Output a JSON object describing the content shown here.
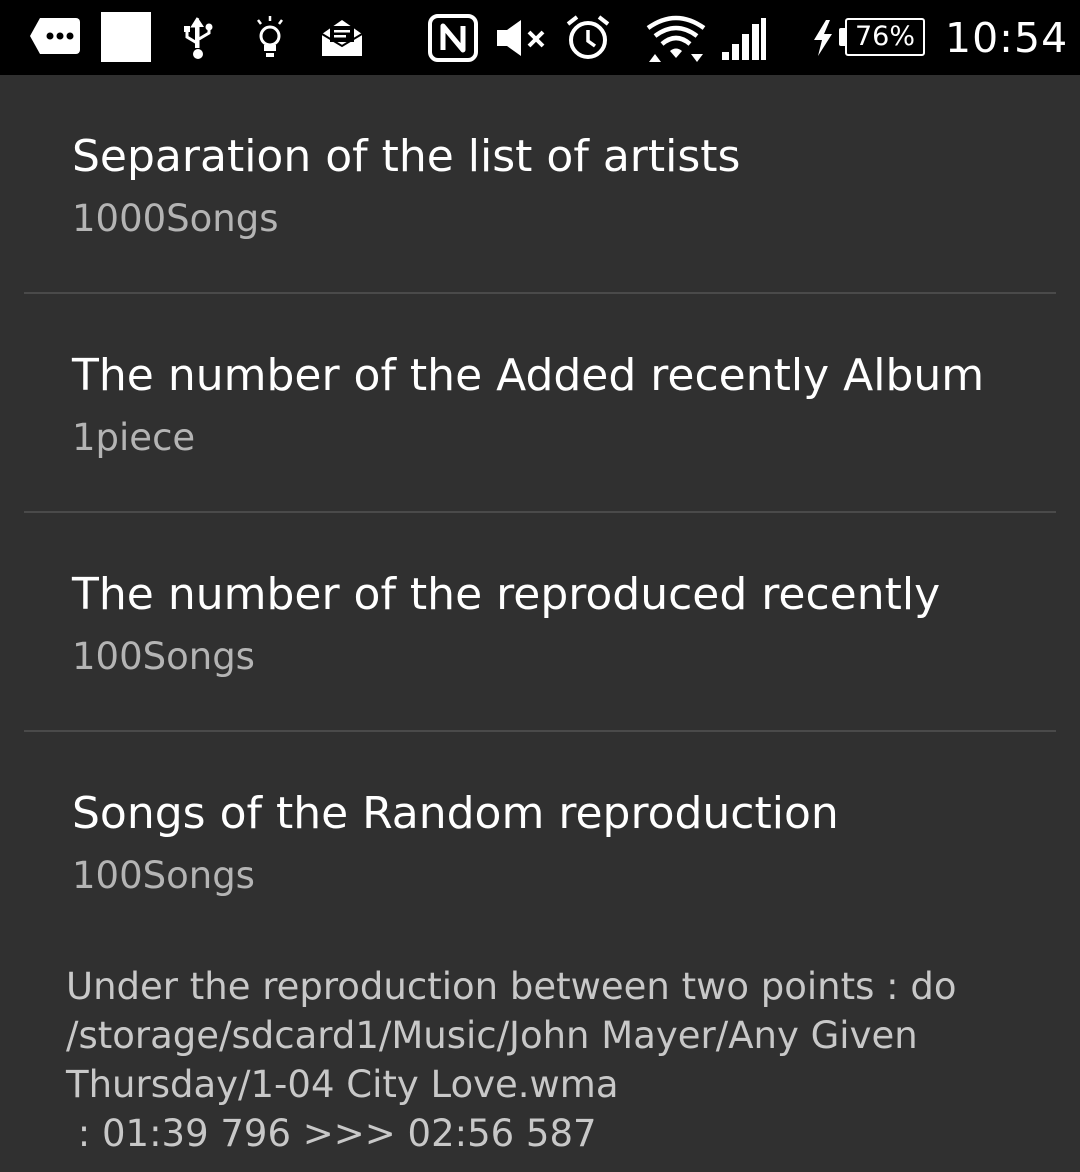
{
  "status_bar": {
    "icons": [
      "more-notifications-icon",
      "blank-notification-icon",
      "usb-icon",
      "lightbulb-icon",
      "email-icon",
      "nfc-icon",
      "mute-icon",
      "alarm-icon",
      "wifi-icon",
      "signal-icon",
      "charging-icon"
    ],
    "battery_text": "76%",
    "time": "10:54"
  },
  "settings": {
    "items": [
      {
        "title": "Separation of the list of artists",
        "summary": "1000Songs"
      },
      {
        "title": "The number of the Added recently Album",
        "summary": "1piece"
      },
      {
        "title": "The number of the reproduced recently",
        "summary": "100Songs"
      },
      {
        "title": "Songs of the Random reproduction",
        "summary": "100Songs"
      }
    ]
  },
  "ab_repeat": {
    "lines": [
      "Under the reproduction between two points : do",
      "/storage/sdcard1/Music/John Mayer/Any Given",
      "Thursday/1-04 City Love.wma",
      " : 01:39 796 >>> 02:56 587"
    ]
  },
  "colors": {
    "background": "#303030",
    "status_bar": "#000000",
    "divider": "#4a4a4a",
    "title_text": "#ffffff",
    "summary_text": "#b4b4b4"
  }
}
